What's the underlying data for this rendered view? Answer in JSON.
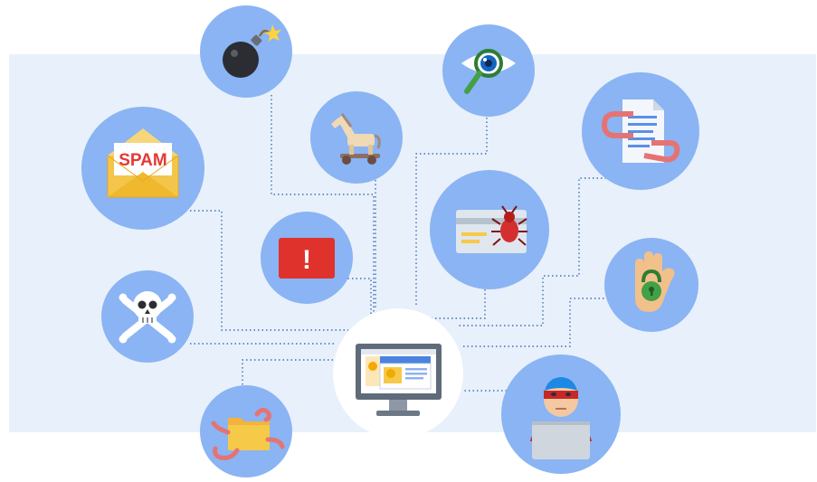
{
  "diagram": {
    "center_node": {
      "icon": "computer-monitor-icon"
    },
    "nodes": [
      {
        "id": "bomb",
        "icon": "bomb-icon"
      },
      {
        "id": "trojan",
        "icon": "trojan-horse-icon"
      },
      {
        "id": "spyware",
        "icon": "eye-magnifier-icon"
      },
      {
        "id": "phishing",
        "icon": "hooked-document-icon"
      },
      {
        "id": "spam",
        "icon": "spam-envelope-icon",
        "label": "SPAM"
      },
      {
        "id": "alert",
        "icon": "alert-icon",
        "label": "!"
      },
      {
        "id": "card-bug",
        "icon": "credit-card-bug-icon"
      },
      {
        "id": "ransom",
        "icon": "lock-hand-icon"
      },
      {
        "id": "skull",
        "icon": "skull-crossbones-icon"
      },
      {
        "id": "worms",
        "icon": "worm-folder-icon"
      },
      {
        "id": "hacker",
        "icon": "hacker-icon"
      }
    ],
    "colors": {
      "background_band": "#e8f0fb",
      "node_fill": "#8ab4f3",
      "connector": "#3f6fb3",
      "spam_red": "#e53935",
      "alert_red": "#e0322d",
      "envelope_yellow": "#f3c54b"
    }
  }
}
